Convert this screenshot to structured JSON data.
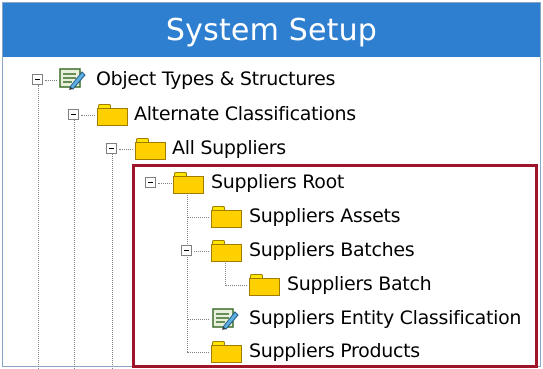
{
  "window": {
    "title": "System Setup",
    "title_bg": "#2f7fd0",
    "highlight_color": "#a0142a"
  },
  "tree": {
    "nodes": [
      {
        "label": "Object Types & Structures",
        "icon": "object-type-icon",
        "expanded": true
      },
      {
        "label": "Alternate Classifications",
        "icon": "folder-icon",
        "expanded": true
      },
      {
        "label": "All Suppliers",
        "icon": "folder-icon",
        "expanded": true
      },
      {
        "label": "Suppliers Root",
        "icon": "folder-icon",
        "expanded": true
      },
      {
        "label": "Suppliers Assets",
        "icon": "folder-icon",
        "expanded": false
      },
      {
        "label": "Suppliers Batches",
        "icon": "folder-icon",
        "expanded": true
      },
      {
        "label": "Suppliers Batch",
        "icon": "folder-icon",
        "expanded": false
      },
      {
        "label": "Suppliers Entity Classification",
        "icon": "object-type-icon",
        "expanded": false
      },
      {
        "label": "Suppliers Products",
        "icon": "folder-icon",
        "expanded": false
      }
    ]
  }
}
